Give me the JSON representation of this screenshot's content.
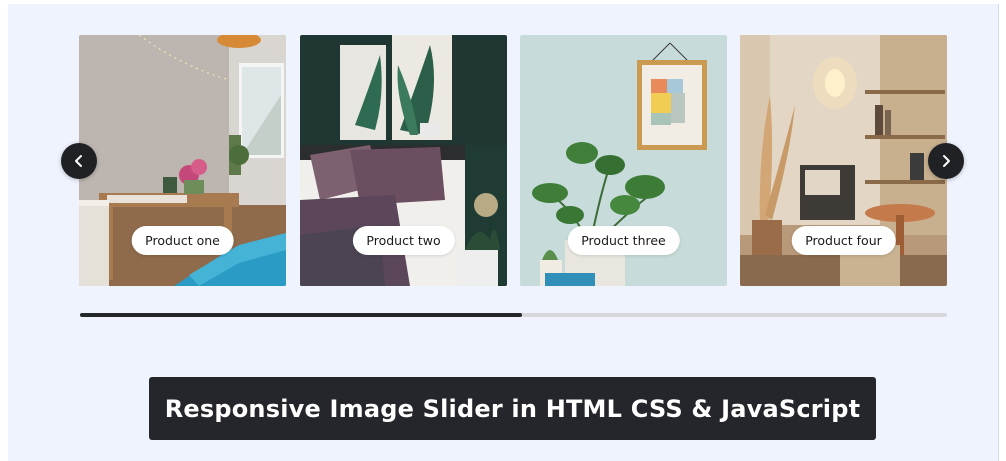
{
  "slider": {
    "cards": [
      {
        "label": "Product one"
      },
      {
        "label": "Product two"
      },
      {
        "label": "Product three"
      },
      {
        "label": "Product four"
      }
    ],
    "prev_icon": "chevron-left-icon",
    "next_icon": "chevron-right-icon",
    "scroll_progress": 0.51
  },
  "banner": {
    "title": "Responsive Image Slider in HTML CSS & JavaScript"
  },
  "colors": {
    "page_background": "#eef3fd",
    "button_background": "#1f2124",
    "scrollbar_track": "#d6d8de",
    "scrollbar_thumb": "#24262b",
    "banner_background": "#24262b"
  }
}
